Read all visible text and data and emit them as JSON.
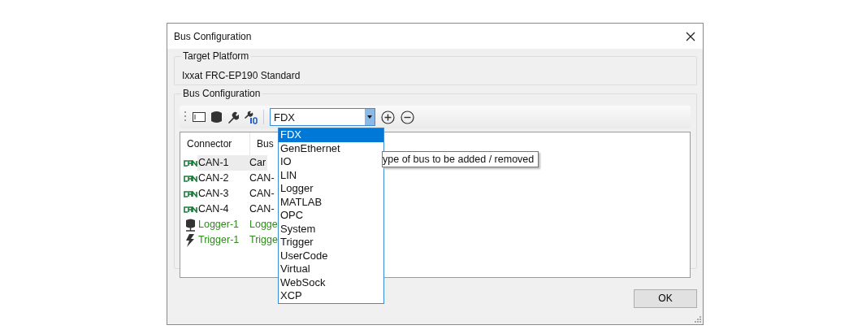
{
  "window": {
    "title": "Bus Configuration"
  },
  "target_platform": {
    "label": "Target Platform",
    "value": "Ixxat FRC-EP190 Standard"
  },
  "bus_configuration": {
    "label": "Bus Configuration",
    "combo": {
      "value": "FDX",
      "expanded": true
    },
    "options": [
      {
        "label": "FDX",
        "selected": true
      },
      {
        "label": "GenEthernet",
        "selected": false
      },
      {
        "label": "IO",
        "selected": false
      },
      {
        "label": "LIN",
        "selected": false
      },
      {
        "label": "Logger",
        "selected": false
      },
      {
        "label": "MATLAB",
        "selected": false
      },
      {
        "label": "OPC",
        "selected": false
      },
      {
        "label": "System",
        "selected": false
      },
      {
        "label": "Trigger",
        "selected": false
      },
      {
        "label": "UserCode",
        "selected": false
      },
      {
        "label": "Virtual",
        "selected": false
      },
      {
        "label": "WebSock",
        "selected": false
      },
      {
        "label": "XCP",
        "selected": false
      }
    ],
    "tooltip": "ype of bus to be added / removed",
    "columns": [
      "Connector",
      "Bus"
    ],
    "rows": [
      {
        "kind": "can",
        "connector": "CAN-1",
        "bus": "Car",
        "selected": true
      },
      {
        "kind": "can",
        "connector": "CAN-2",
        "bus": "CAN-",
        "selected": false
      },
      {
        "kind": "can",
        "connector": "CAN-3",
        "bus": "CAN-",
        "selected": false
      },
      {
        "kind": "can",
        "connector": "CAN-4",
        "bus": "CAN-",
        "selected": false
      },
      {
        "kind": "logger",
        "connector": "Logger-1",
        "bus": "Logge",
        "selected": false
      },
      {
        "kind": "trigger",
        "connector": "Trigger-1",
        "bus": "Trigge",
        "selected": false
      }
    ]
  },
  "buttons": [
    {
      "label": "OK"
    }
  ]
}
